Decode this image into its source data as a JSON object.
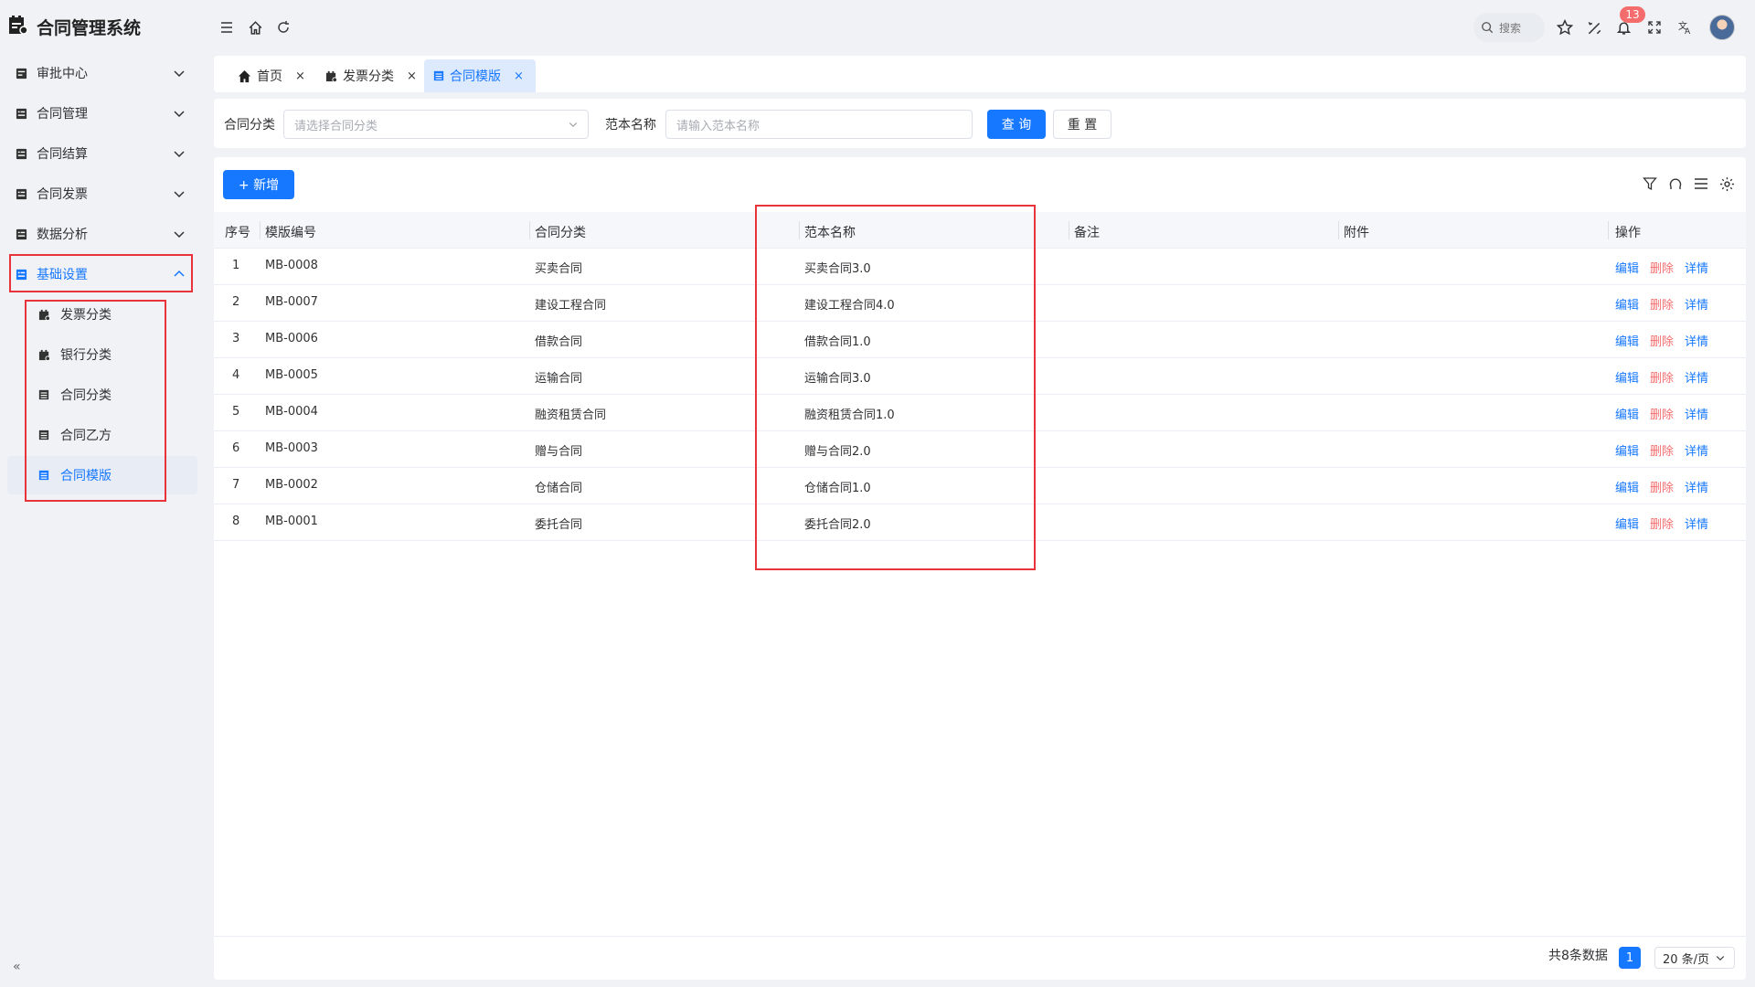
{
  "app": {
    "title": "合同管理系统"
  },
  "sidebar": {
    "items": [
      {
        "label": "审批中心",
        "icon": "approval-icon"
      },
      {
        "label": "合同管理",
        "icon": "contract-icon"
      },
      {
        "label": "合同结算",
        "icon": "settlement-icon"
      },
      {
        "label": "合同发票",
        "icon": "invoice-icon"
      },
      {
        "label": "数据分析",
        "icon": "analysis-icon"
      },
      {
        "label": "基础设置",
        "icon": "settings-icon",
        "expanded": true,
        "active": true
      }
    ],
    "subitems": [
      {
        "label": "发票分类",
        "icon": "invoice-category-icon"
      },
      {
        "label": "银行分类",
        "icon": "bank-category-icon"
      },
      {
        "label": "合同分类",
        "icon": "contract-category-icon"
      },
      {
        "label": "合同乙方",
        "icon": "contract-party-icon"
      },
      {
        "label": "合同模版",
        "icon": "contract-template-icon",
        "active": true
      }
    ],
    "collapse_label": "«"
  },
  "header": {
    "search_label": "搜索",
    "notification_count": "13",
    "icons": [
      "menu-fold-icon",
      "home-icon",
      "refresh-icon",
      "search-icon",
      "star-icon",
      "theme-icon",
      "bell-icon",
      "fullscreen-icon",
      "translate-icon",
      "avatar"
    ]
  },
  "tabs": [
    {
      "label": "首页",
      "icon": "home-icon",
      "close": "×"
    },
    {
      "label": "发票分类",
      "icon": "invoice-category-icon",
      "close": "×"
    },
    {
      "label": "合同模版",
      "icon": "contract-template-icon",
      "close": "×",
      "active": true
    }
  ],
  "filter": {
    "category_label": "合同分类",
    "category_placeholder": "请选择合同分类",
    "name_label": "范本名称",
    "name_placeholder": "请输入范本名称",
    "query_button": "查 询",
    "reset_button": "重 置"
  },
  "toolbar": {
    "add_button": "+ 新增"
  },
  "table": {
    "columns": [
      "序号",
      "模版编号",
      "合同分类",
      "范本名称",
      "备注",
      "附件",
      "操作"
    ],
    "rows": [
      {
        "index": "1",
        "code": "MB-0008",
        "category": "买卖合同",
        "name": "买卖合同3.0",
        "remark": "",
        "attachment": ""
      },
      {
        "index": "2",
        "code": "MB-0007",
        "category": "建设工程合同",
        "name": "建设工程合同4.0",
        "remark": "",
        "attachment": ""
      },
      {
        "index": "3",
        "code": "MB-0006",
        "category": "借款合同",
        "name": "借款合同1.0",
        "remark": "",
        "attachment": ""
      },
      {
        "index": "4",
        "code": "MB-0005",
        "category": "运输合同",
        "name": "运输合同3.0",
        "remark": "",
        "attachment": ""
      },
      {
        "index": "5",
        "code": "MB-0004",
        "category": "融资租赁合同",
        "name": "融资租赁合同1.0",
        "remark": "",
        "attachment": ""
      },
      {
        "index": "6",
        "code": "MB-0003",
        "category": "赠与合同",
        "name": "赠与合同2.0",
        "remark": "",
        "attachment": ""
      },
      {
        "index": "7",
        "code": "MB-0002",
        "category": "仓储合同",
        "name": "仓储合同1.0",
        "remark": "",
        "attachment": ""
      },
      {
        "index": "8",
        "code": "MB-0001",
        "category": "委托合同",
        "name": "委托合同2.0",
        "remark": "",
        "attachment": ""
      }
    ],
    "actions": {
      "edit": "编辑",
      "delete": "删除",
      "detail": "详情"
    }
  },
  "pagination": {
    "total_text": "共8条数据",
    "current_page": "1",
    "page_size": "20 条/页"
  },
  "colors": {
    "primary": "#1677ff",
    "danger": "#f56c6c",
    "highlight_box": "#e8333b"
  }
}
